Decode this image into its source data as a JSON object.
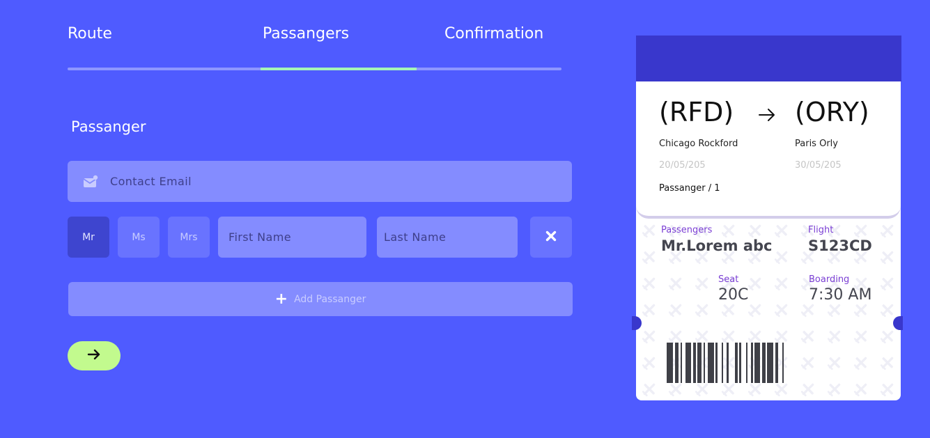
{
  "steps": {
    "route": "Route",
    "passengers": "Passangers",
    "confirmation": "Confirmation",
    "active": "Passangers"
  },
  "form": {
    "section_title": "Passanger",
    "email_placeholder": "Contact Email",
    "titles": [
      "Mr",
      "Ms",
      "Mrs"
    ],
    "selected_title": "Mr",
    "first_name_placeholder": "First Name",
    "last_name_placeholder": "Last Name",
    "add_passenger_label": "Add Passanger"
  },
  "ticket": {
    "from_code": "(RFD)",
    "to_code": "(ORY)",
    "from_city": "Chicago Rockford",
    "to_city": "Paris Orly",
    "from_date": "20/05/205",
    "to_date": "30/05/205",
    "passenger_count": "Passanger / 1",
    "passengers_label": "Passengers",
    "passenger_name": "Mr.Lorem abc",
    "flight_label": "Flight",
    "flight_number": "S123CD",
    "seat_label": "Seat",
    "seat": "20C",
    "boarding_label": "Boarding",
    "boarding_time": "7:30 AM"
  },
  "colors": {
    "background": "#4f5bff",
    "accent_green": "#c2fa8e",
    "step_active": "#a6f5b6",
    "ticket_header": "#3937cc",
    "label_purple": "#7b3fd4"
  },
  "icons": {
    "email": "mail-icon",
    "remove": "close-icon",
    "add": "plus-icon",
    "next": "arrow-right-icon",
    "route": "arrow-right-icon"
  }
}
